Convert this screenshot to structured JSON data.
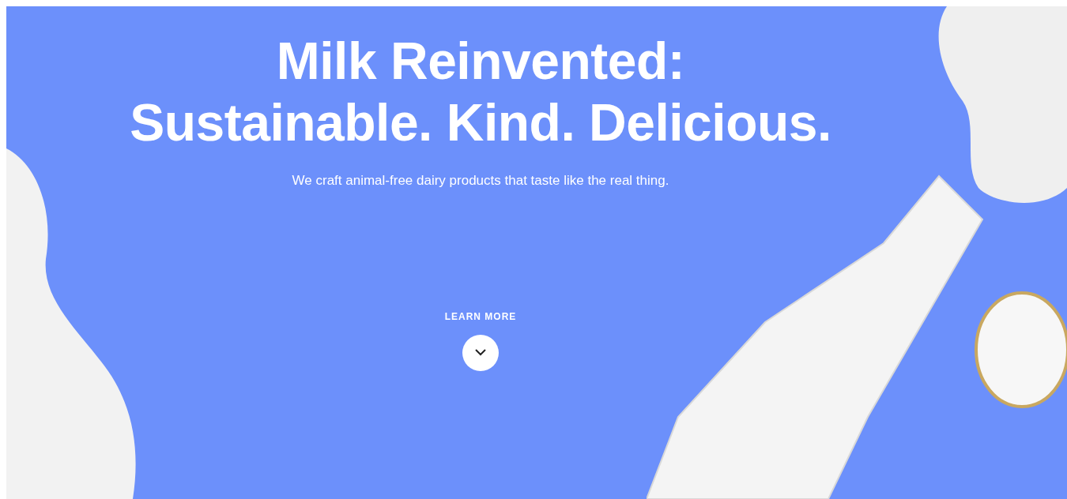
{
  "hero": {
    "headline": [
      "Milk Reinvented:",
      "Sustainable. Kind. Delicious."
    ],
    "subtitle": "We craft animal-free dairy products that taste like the real thing.",
    "cta": {
      "label": "LEARN MORE"
    }
  }
}
